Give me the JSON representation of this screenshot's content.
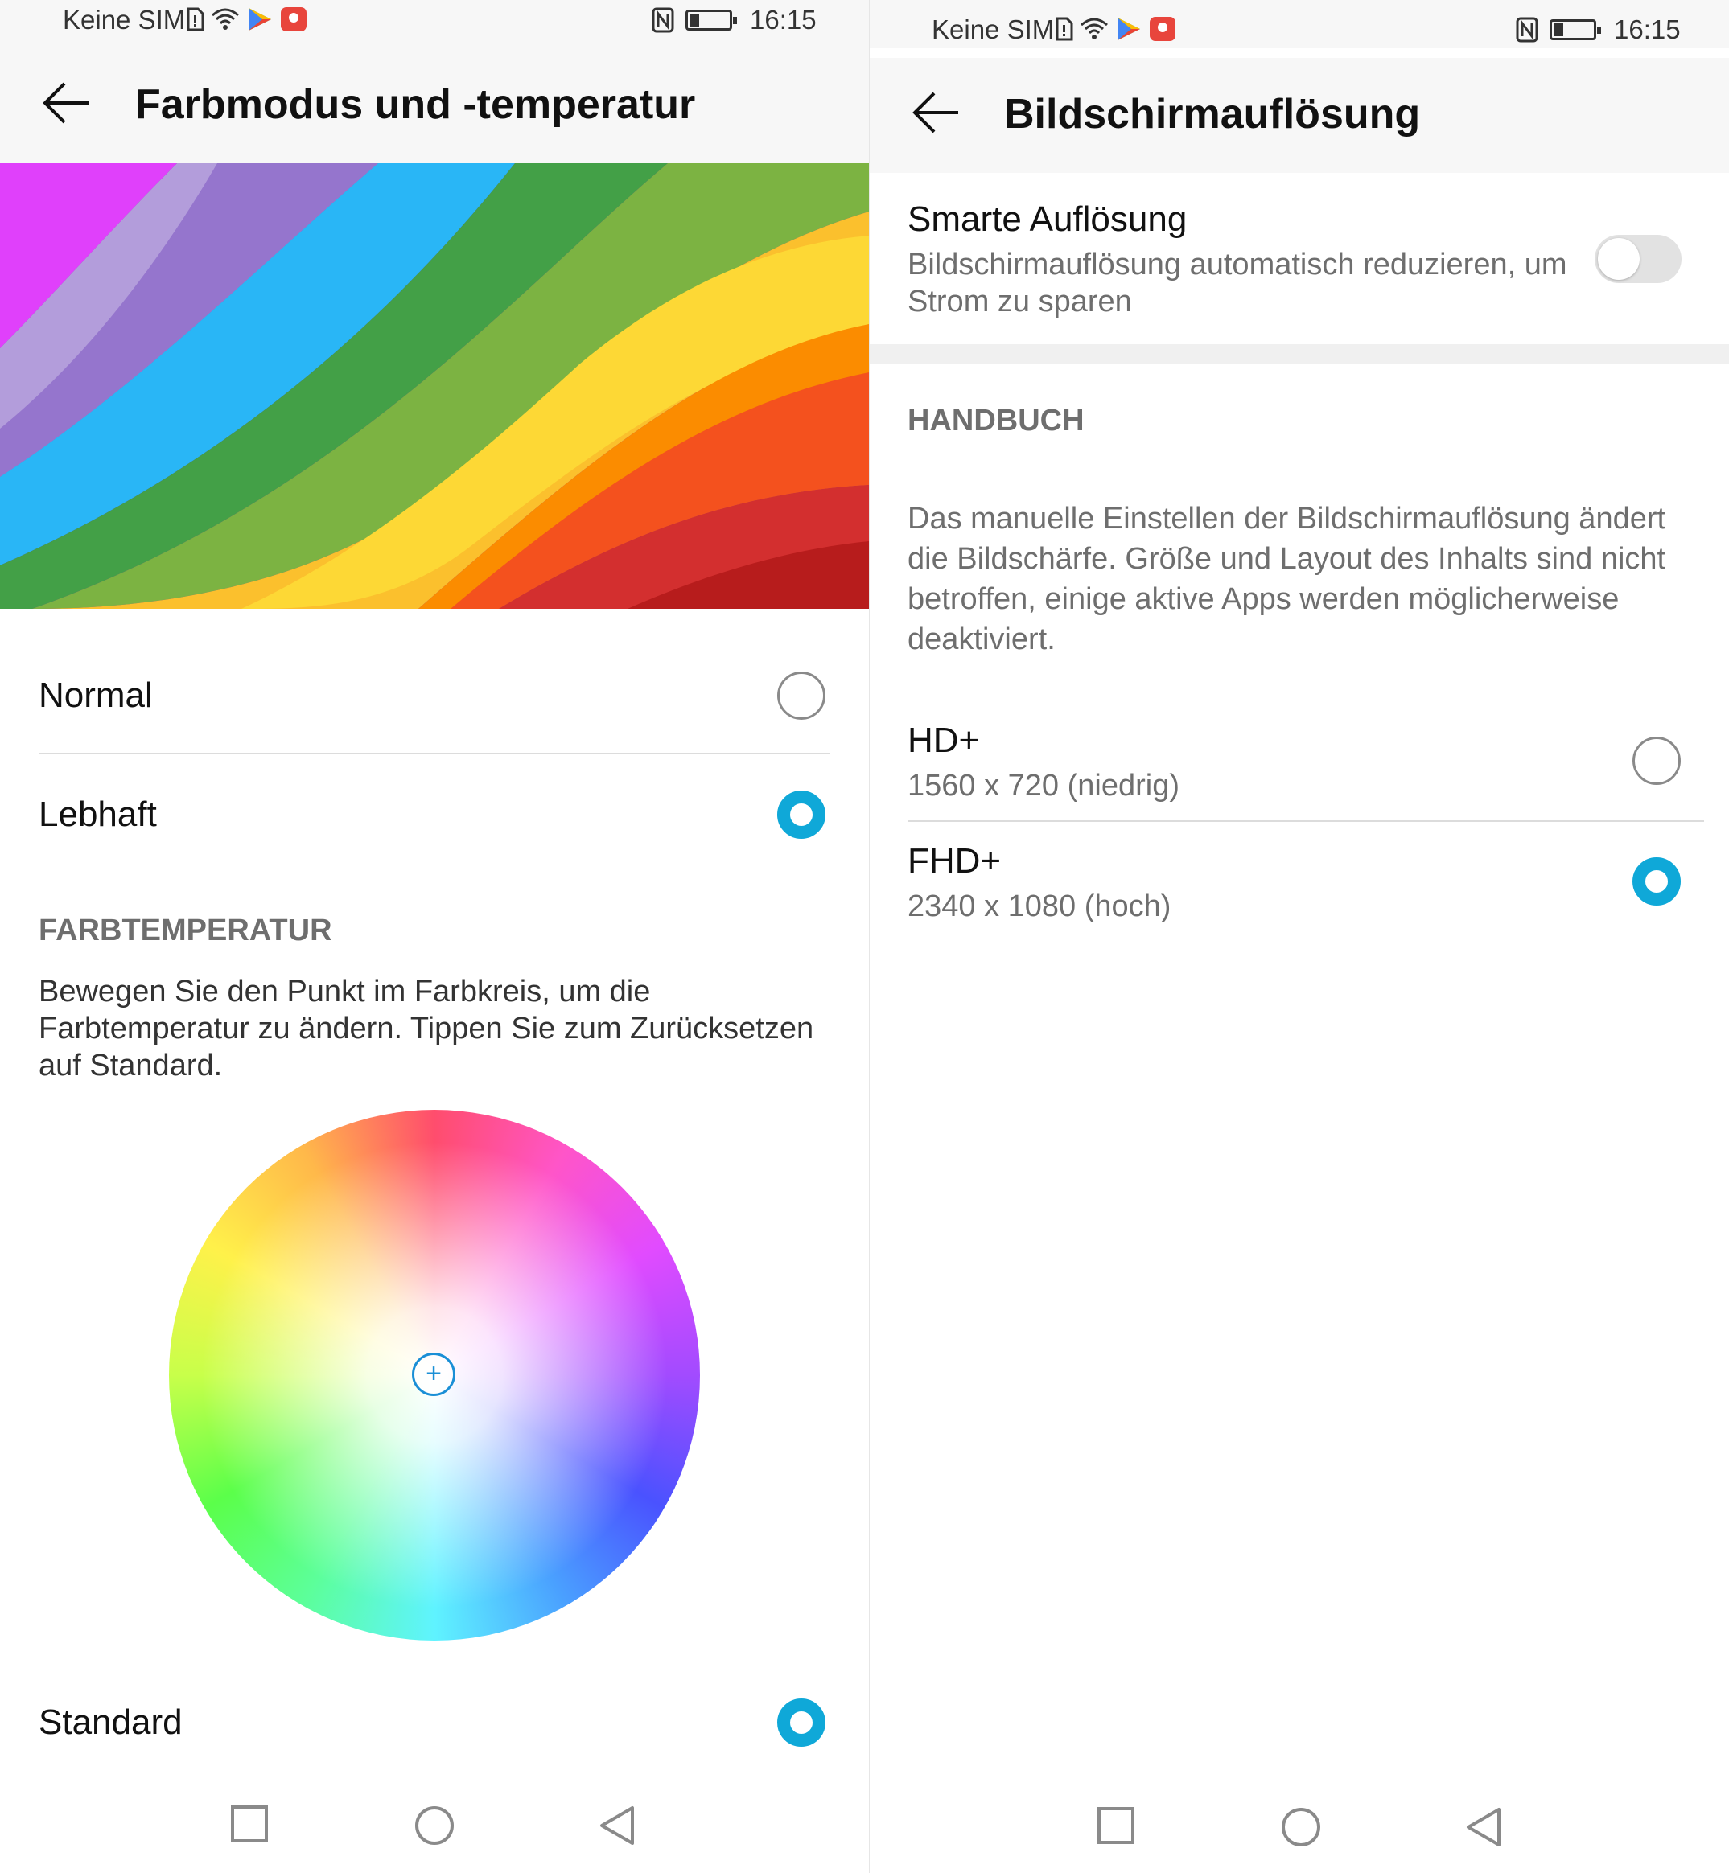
{
  "left_screen": {
    "status": {
      "carrier": "Keine SIM",
      "time": "16:15"
    },
    "title": "Farbmodus und -temperatur",
    "modes": [
      {
        "label": "Normal",
        "selected": false
      },
      {
        "label": "Lebhaft",
        "selected": true
      }
    ],
    "section_title": "FARBTEMPERATUR",
    "description": "Bewegen Sie den Punkt im Farbkreis, um die Farbtemperatur zu ändern. Tippen Sie zum Zurücksetzen auf Standard.",
    "wheel_point_symbol": "+",
    "standard": {
      "label": "Standard",
      "selected": true
    }
  },
  "right_screen": {
    "status": {
      "carrier": "Keine SIM",
      "time": "16:15"
    },
    "title": "Bildschirmauflösung",
    "smart": {
      "label": "Smarte Auflösung",
      "description": "Bildschirmauflösung automatisch reduzieren, um Strom zu sparen",
      "enabled": false
    },
    "section_title": "HANDBUCH",
    "description": "Das manuelle Einstellen der Bildschirmauflösung ändert die Bildschärfe. Größe und Layout des Inhalts sind nicht betroffen, einige aktive Apps werden möglicherweise deaktiviert.",
    "options": [
      {
        "label": "HD+",
        "detail": "1560 x 720 (niedrig)",
        "selected": false
      },
      {
        "label": "FHD+",
        "detail": "2340 x 1080 (hoch)",
        "selected": true
      }
    ]
  },
  "colors": {
    "accent": "#0fa8d8",
    "appbar_bg": "#f7f7f7",
    "secondary_text": "#6e6e6e"
  }
}
